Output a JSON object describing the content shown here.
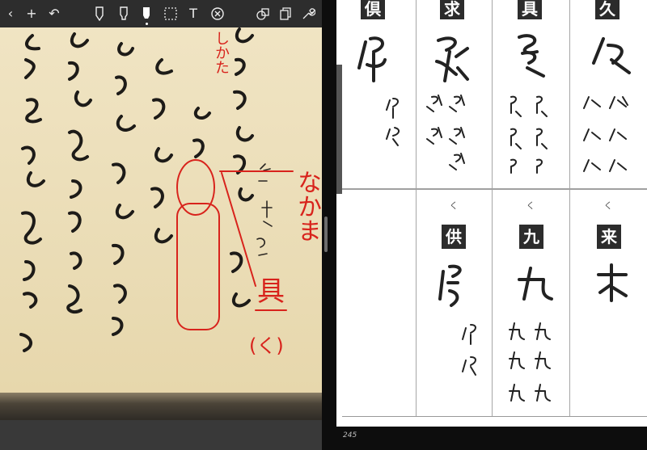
{
  "toolbar": {
    "back_icon": "chevron-left-icon",
    "add_icon": "plus-icon",
    "undo_icon": "undo-icon",
    "pen_icon": "pen-icon",
    "marker_icon": "marker-icon",
    "highlighter_icon": "highlighter-icon",
    "lasso_icon": "lasso-icon",
    "text_icon": "text-icon",
    "eraser_icon": "eraser-icon",
    "shapes_icon": "shapes-icon",
    "pages_icon": "pages-icon",
    "settings_icon": "wrench-icon"
  },
  "annotations": {
    "top_note": "しかた",
    "side_note": "なかま",
    "bottom_note": "具",
    "bottom_reading": "(く)"
  },
  "dictionary": {
    "top_row": [
      {
        "kanji": "倶"
      },
      {
        "kanji": "求"
      },
      {
        "kanji": "具"
      },
      {
        "kanji": "久"
      }
    ],
    "bottom_row": [
      {
        "kanji": "供",
        "reading": "く"
      },
      {
        "kanji": "九",
        "reading": "く"
      },
      {
        "kanji": "来",
        "reading": "く"
      }
    ],
    "page_number": "245"
  },
  "colors": {
    "annotation_red": "#d8231c",
    "paper": "#ecdeb8",
    "ink": "#1a1a1a"
  }
}
